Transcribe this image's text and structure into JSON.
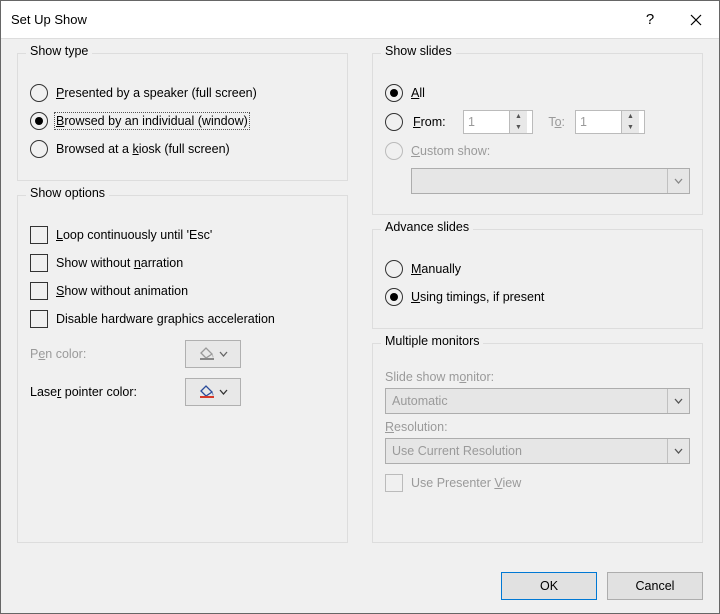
{
  "title": "Set Up Show",
  "groups": {
    "show_type": {
      "title": "Show type",
      "opt1": "resented by a speaker (full screen)",
      "opt1_u": "P",
      "opt2": "rowsed by an individual (window)",
      "opt2_u": "B",
      "opt3": "iosk (full screen)",
      "opt3_pre": "Browsed at a ",
      "opt3_u": "k"
    },
    "show_options": {
      "title": "Show options",
      "loop_u": "L",
      "loop": "oop continuously until 'Esc'",
      "narr_pre": "Show without ",
      "narr_u": "n",
      "narr": "arration",
      "anim_u": "S",
      "anim": "how without animation",
      "hw": "Disable hardware graphics acceleration",
      "pen_u": "e",
      "pen_pre": "P",
      "pen": "n color:",
      "laser_u": "r",
      "laser_pre": "Lase",
      "laser": " pointer color:"
    },
    "show_slides": {
      "title": "Show slides",
      "all_u": "A",
      "all": "ll",
      "from_u": "F",
      "from": "rom:",
      "to_u": "o",
      "to_pre": "T",
      "to": ":",
      "from_val": "1",
      "to_val": "1",
      "custom_u": "C",
      "custom": "ustom show:"
    },
    "advance": {
      "title": "Advance slides",
      "manual_u": "M",
      "manual": "anually",
      "timing_u": "U",
      "timing": "sing timings, if present"
    },
    "monitors": {
      "title": "Multiple monitors",
      "mon_label": "nitor:",
      "mon_label_pre": "Slide show m",
      "mon_label_u": "o",
      "mon_value": "Automatic",
      "res_label_u": "R",
      "res_label": "esolution:",
      "res_value": "Use Current Resolution",
      "presenter_pre": "Use Presenter ",
      "presenter_u": "V",
      "presenter": "iew"
    }
  },
  "buttons": {
    "ok": "OK",
    "cancel": "Cancel"
  }
}
